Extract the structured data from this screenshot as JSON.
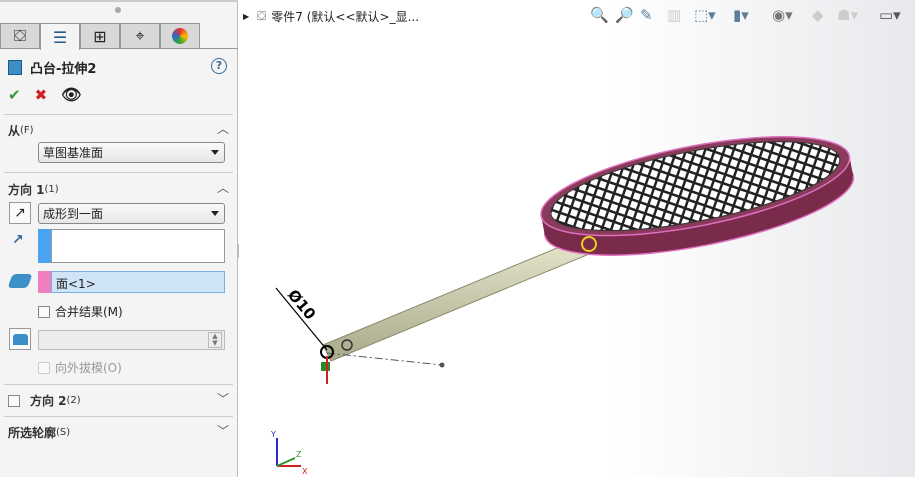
{
  "panel": {
    "feature_title": "凸台-拉伸2",
    "help_icon": "?",
    "from": {
      "label": "从",
      "shortcut": "(F)",
      "value": "草图基准面"
    },
    "direction1": {
      "label": "方向 1",
      "shortcut": "(1)",
      "end_condition": "成形到一面",
      "direction_value": "",
      "face_value": "面<1>",
      "merge_label": "合并结果(M)",
      "draft_value": "",
      "draft_outward_label": "向外拔模(O)"
    },
    "direction2": {
      "label": "方向 2",
      "shortcut": "(2)"
    },
    "selected_contours": {
      "label": "所选轮廓",
      "shortcut": "(S)"
    },
    "colors": {
      "direction_swatch": "#4aa3f0",
      "face_swatch": "#f07fc0",
      "face_highlight": "#cfe4f7"
    }
  },
  "viewport": {
    "doc_title": "零件7  (默认<<默认>_显...",
    "dimension": "Ø10",
    "triad": {
      "x": "X",
      "y": "Y",
      "z": "Z"
    }
  }
}
